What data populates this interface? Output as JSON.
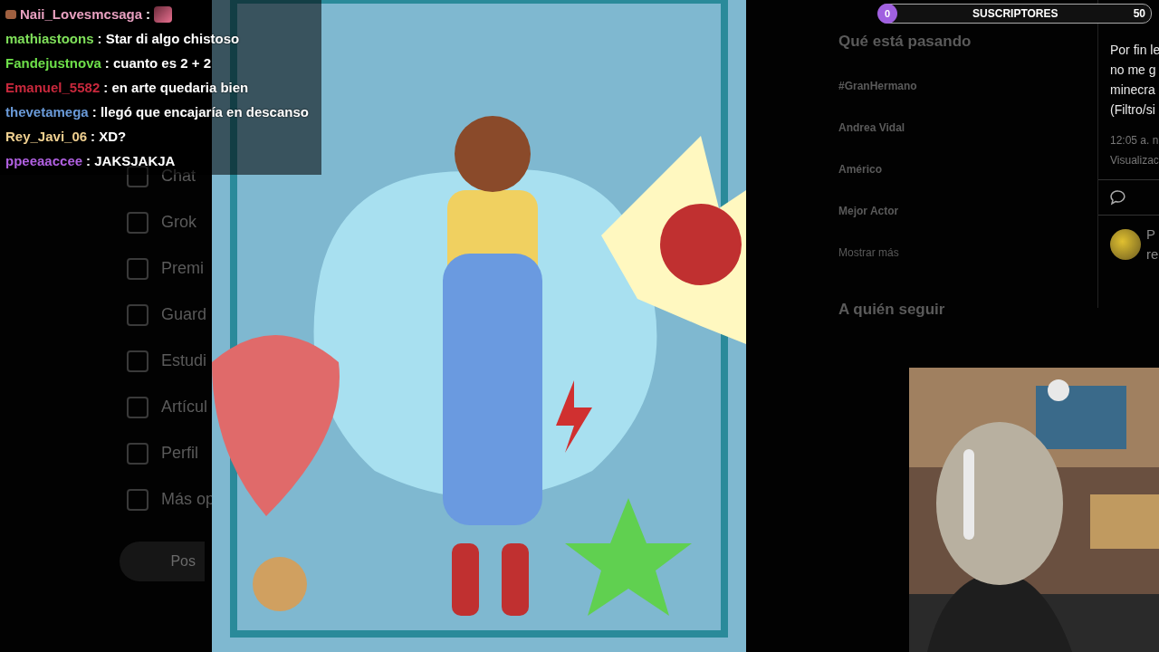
{
  "chat": [
    {
      "user": "Naii_Lovesmcsaga",
      "message": ":",
      "color": "#e8a0c0",
      "badge": true,
      "emote": true
    },
    {
      "user": "mathiastoons",
      "message": ": Star di algo chistoso",
      "color": "#7fe05a",
      "badge": false,
      "emote": false
    },
    {
      "user": "Fandejustnova",
      "message": ": cuanto es 2 + 2",
      "color": "#6ee04a",
      "badge": false,
      "emote": false
    },
    {
      "user": "Emanuel_5582",
      "message": ": en arte quedaria bien",
      "color": "#c8283c",
      "badge": false,
      "emote": false
    },
    {
      "user": "thevetamega",
      "message": ": llegó que encajaría en descanso",
      "color": "#6a9ad8",
      "badge": false,
      "emote": false
    },
    {
      "user": "Rey_Javi_06",
      "message": ": XD?",
      "color": "#f0d090",
      "badge": false,
      "emote": false
    },
    {
      "user": "ppeeaaccee",
      "message": ": JAKSJAKJA",
      "color": "#b060e0",
      "badge": false,
      "emote": false
    }
  ],
  "sub_goal": {
    "current": "0",
    "label": "SUSCRIPTORES",
    "target": "50",
    "level": 0
  },
  "background_page": {
    "nav": [
      "Chat",
      "Grok",
      "Premi",
      "Guard",
      "Estudi",
      "Artícul",
      "Perfil",
      "Más op"
    ],
    "post_button": "Pos",
    "trends_title": "Qué está pasando",
    "trends": [
      "#GranHermano",
      "Andrea Vidal",
      "Américo",
      "Mejor Actor"
    ],
    "show_more": "Mostrar más",
    "follow_title": "A quién seguir",
    "tweet_lines": [
      "Por fin le",
      "no me g",
      "minecra",
      "(Filtro/si"
    ],
    "tweet_time": "12:05 a. n",
    "tweet_views": "Visualizac",
    "reply_lines": [
      "P",
      "re"
    ]
  }
}
